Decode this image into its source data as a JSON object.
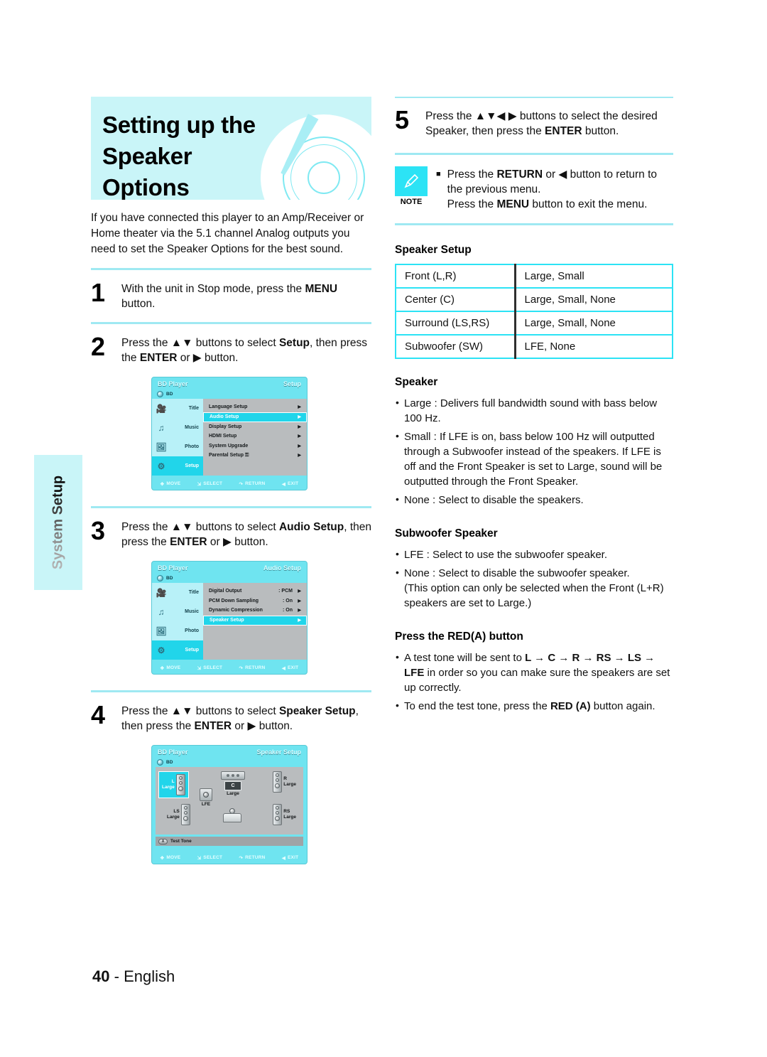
{
  "side_tab": {
    "label": "System Setup"
  },
  "title": {
    "line1": "Setting up the Speaker",
    "line2": "Options"
  },
  "intro": "If you have connected this player to an Amp/Receiver or Home theater via the 5.1 channel Analog outputs you need to set the Speaker Options for the best sound.",
  "steps": [
    {
      "num": "1",
      "text_html": "With the unit in Stop mode, press the <b>MENU</b> button."
    },
    {
      "num": "2",
      "text_html": "Press the ▲▼ buttons to select <b>Setup</b>, then press the <b>ENTER</b> or ▶ button."
    },
    {
      "num": "3",
      "text_html": "Press the ▲▼ buttons to select <b>Audio Setup</b>, then press the  <b>ENTER</b> or ▶ button."
    },
    {
      "num": "4",
      "text_html": "Press the ▲▼ buttons to select <b>Speaker Setup</b>, then press the <b>ENTER</b> or ▶ button."
    },
    {
      "num": "5",
      "text_html": "Press the ▲▼◀ ▶ buttons to select the desired Speaker, then press the <b>ENTER</b> button."
    }
  ],
  "osd_setup": {
    "brand": "BD Player",
    "mode": "Setup",
    "disc_label": "BD",
    "side_items": [
      {
        "icon": "film-reel-icon",
        "label": "Title",
        "active": false
      },
      {
        "icon": "music-note-icon",
        "label": "Music",
        "active": false
      },
      {
        "icon": "photo-icon",
        "label": "Photo",
        "active": false
      },
      {
        "icon": "gear-icon",
        "label": "Setup",
        "active": true
      }
    ],
    "rows": [
      {
        "label": "Language Setup",
        "value": "",
        "selected": false
      },
      {
        "label": "Audio Setup",
        "value": "",
        "selected": true
      },
      {
        "label": "Display Setup",
        "value": "",
        "selected": false
      },
      {
        "label": "HDMI Setup",
        "value": "",
        "selected": false
      },
      {
        "label": "System Upgrade",
        "value": "",
        "selected": false
      },
      {
        "label": "Parental Setup ⚿",
        "value": "",
        "selected": false
      }
    ],
    "footer": [
      "MOVE",
      "SELECT",
      "RETURN",
      "EXIT"
    ]
  },
  "osd_audio": {
    "brand": "BD Player",
    "mode": "Audio Setup",
    "disc_label": "BD",
    "side_items": [
      {
        "icon": "film-reel-icon",
        "label": "Title",
        "active": false
      },
      {
        "icon": "music-note-icon",
        "label": "Music",
        "active": false
      },
      {
        "icon": "photo-icon",
        "label": "Photo",
        "active": false
      },
      {
        "icon": "gear-icon",
        "label": "Setup",
        "active": true
      }
    ],
    "rows": [
      {
        "label": "Digital Output",
        "value": ": PCM",
        "selected": false
      },
      {
        "label": "PCM Down Sampling",
        "value": ": On",
        "selected": false
      },
      {
        "label": "Dynamic Compression",
        "value": ": On",
        "selected": false
      },
      {
        "label": "Speaker Setup",
        "value": "",
        "selected": true
      }
    ],
    "footer": [
      "MOVE",
      "SELECT",
      "RETURN",
      "EXIT"
    ]
  },
  "osd_speaker": {
    "brand": "BD Player",
    "mode": "Speaker Setup",
    "disc_label": "BD",
    "speakers": [
      {
        "id": "L",
        "name": "L",
        "size": "Large",
        "selected": true
      },
      {
        "id": "R",
        "name": "R",
        "size": "Large",
        "selected": false
      },
      {
        "id": "C",
        "name": "C",
        "size": "Large",
        "selected": false
      },
      {
        "id": "LS",
        "name": "LS",
        "size": "Large",
        "selected": false
      },
      {
        "id": "RS",
        "name": "RS",
        "size": "Large",
        "selected": false
      },
      {
        "id": "LFE",
        "name": "LFE",
        "size": "",
        "selected": false
      }
    ],
    "test_tone": "Test Tone",
    "test_tone_key": "A",
    "footer": [
      "MOVE",
      "SELECT",
      "RETURN",
      "EXIT"
    ]
  },
  "note": {
    "caption": "NOTE",
    "icon": "pencil-icon",
    "line1_html": "Press the <b>RETURN</b> or ◀ button to return to the previous menu.",
    "line2_html": "Press the <b>MENU</b> button to exit the menu."
  },
  "speaker_setup_table": {
    "heading": "Speaker Setup",
    "rows": [
      {
        "key": "Front (L,R)",
        "value": "Large, Small"
      },
      {
        "key": "Center (C)",
        "value": "Large, Small, None"
      },
      {
        "key": "Surround (LS,RS)",
        "value": "Large, Small, None"
      },
      {
        "key": "Subwoofer (SW)",
        "value": "LFE, None"
      }
    ]
  },
  "speaker_section": {
    "heading": "Speaker",
    "items_html": [
      "Large : Delivers full bandwidth sound with bass below 100 Hz.",
      "Small : If LFE is on, bass below 100 Hz will outputted through a Subwoofer instead of the speakers. If LFE is off and the Front Speaker is set to Large, sound will be outputted through the Front Speaker.",
      "None : Select to disable the speakers."
    ]
  },
  "subwoofer_section": {
    "heading": "Subwoofer Speaker",
    "items_html": [
      "LFE : Select to use the subwoofer speaker.",
      "None : Select to disable the subwoofer speaker.<span class=\"ind\">(This option can only be selected when the Front (L+R) speakers are set to Large.)</span>"
    ]
  },
  "red_section": {
    "heading": "Press the RED(A) button",
    "items_html": [
      "A test tone will be sent to <span class=\"b\">L → C → R →  RS → LS → LFE</span> in order so you can make sure the speakers are set up correctly.",
      "To end the test tone, press the <span class=\"b\">RED (A)</span> button again."
    ]
  },
  "footer": {
    "page": "40",
    "dash": "-",
    "language": "English"
  },
  "colors": {
    "accent_cyan": "#2ce3f5",
    "banner": "#c9f5f8",
    "osd_bg": "#6fe4f0",
    "osd_panel": "#b9bcbe"
  }
}
